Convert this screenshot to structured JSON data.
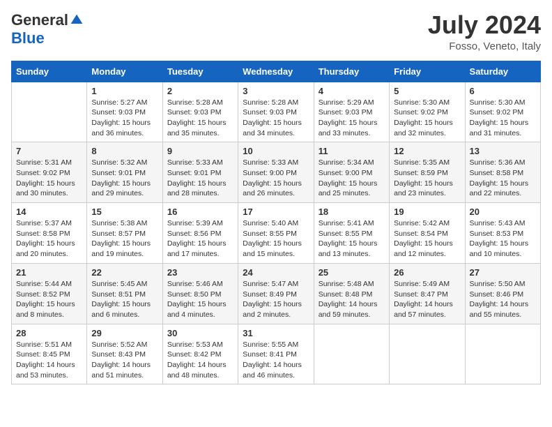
{
  "header": {
    "logo_general": "General",
    "logo_blue": "Blue",
    "title": "July 2024",
    "subtitle": "Fosso, Veneto, Italy"
  },
  "days_of_week": [
    "Sunday",
    "Monday",
    "Tuesday",
    "Wednesday",
    "Thursday",
    "Friday",
    "Saturday"
  ],
  "weeks": [
    [
      {
        "day": "",
        "sunrise": "",
        "sunset": "",
        "daylight": ""
      },
      {
        "day": "1",
        "sunrise": "Sunrise: 5:27 AM",
        "sunset": "Sunset: 9:03 PM",
        "daylight": "Daylight: 15 hours and 36 minutes."
      },
      {
        "day": "2",
        "sunrise": "Sunrise: 5:28 AM",
        "sunset": "Sunset: 9:03 PM",
        "daylight": "Daylight: 15 hours and 35 minutes."
      },
      {
        "day": "3",
        "sunrise": "Sunrise: 5:28 AM",
        "sunset": "Sunset: 9:03 PM",
        "daylight": "Daylight: 15 hours and 34 minutes."
      },
      {
        "day": "4",
        "sunrise": "Sunrise: 5:29 AM",
        "sunset": "Sunset: 9:03 PM",
        "daylight": "Daylight: 15 hours and 33 minutes."
      },
      {
        "day": "5",
        "sunrise": "Sunrise: 5:30 AM",
        "sunset": "Sunset: 9:02 PM",
        "daylight": "Daylight: 15 hours and 32 minutes."
      },
      {
        "day": "6",
        "sunrise": "Sunrise: 5:30 AM",
        "sunset": "Sunset: 9:02 PM",
        "daylight": "Daylight: 15 hours and 31 minutes."
      }
    ],
    [
      {
        "day": "7",
        "sunrise": "Sunrise: 5:31 AM",
        "sunset": "Sunset: 9:02 PM",
        "daylight": "Daylight: 15 hours and 30 minutes."
      },
      {
        "day": "8",
        "sunrise": "Sunrise: 5:32 AM",
        "sunset": "Sunset: 9:01 PM",
        "daylight": "Daylight: 15 hours and 29 minutes."
      },
      {
        "day": "9",
        "sunrise": "Sunrise: 5:33 AM",
        "sunset": "Sunset: 9:01 PM",
        "daylight": "Daylight: 15 hours and 28 minutes."
      },
      {
        "day": "10",
        "sunrise": "Sunrise: 5:33 AM",
        "sunset": "Sunset: 9:00 PM",
        "daylight": "Daylight: 15 hours and 26 minutes."
      },
      {
        "day": "11",
        "sunrise": "Sunrise: 5:34 AM",
        "sunset": "Sunset: 9:00 PM",
        "daylight": "Daylight: 15 hours and 25 minutes."
      },
      {
        "day": "12",
        "sunrise": "Sunrise: 5:35 AM",
        "sunset": "Sunset: 8:59 PM",
        "daylight": "Daylight: 15 hours and 23 minutes."
      },
      {
        "day": "13",
        "sunrise": "Sunrise: 5:36 AM",
        "sunset": "Sunset: 8:58 PM",
        "daylight": "Daylight: 15 hours and 22 minutes."
      }
    ],
    [
      {
        "day": "14",
        "sunrise": "Sunrise: 5:37 AM",
        "sunset": "Sunset: 8:58 PM",
        "daylight": "Daylight: 15 hours and 20 minutes."
      },
      {
        "day": "15",
        "sunrise": "Sunrise: 5:38 AM",
        "sunset": "Sunset: 8:57 PM",
        "daylight": "Daylight: 15 hours and 19 minutes."
      },
      {
        "day": "16",
        "sunrise": "Sunrise: 5:39 AM",
        "sunset": "Sunset: 8:56 PM",
        "daylight": "Daylight: 15 hours and 17 minutes."
      },
      {
        "day": "17",
        "sunrise": "Sunrise: 5:40 AM",
        "sunset": "Sunset: 8:55 PM",
        "daylight": "Daylight: 15 hours and 15 minutes."
      },
      {
        "day": "18",
        "sunrise": "Sunrise: 5:41 AM",
        "sunset": "Sunset: 8:55 PM",
        "daylight": "Daylight: 15 hours and 13 minutes."
      },
      {
        "day": "19",
        "sunrise": "Sunrise: 5:42 AM",
        "sunset": "Sunset: 8:54 PM",
        "daylight": "Daylight: 15 hours and 12 minutes."
      },
      {
        "day": "20",
        "sunrise": "Sunrise: 5:43 AM",
        "sunset": "Sunset: 8:53 PM",
        "daylight": "Daylight: 15 hours and 10 minutes."
      }
    ],
    [
      {
        "day": "21",
        "sunrise": "Sunrise: 5:44 AM",
        "sunset": "Sunset: 8:52 PM",
        "daylight": "Daylight: 15 hours and 8 minutes."
      },
      {
        "day": "22",
        "sunrise": "Sunrise: 5:45 AM",
        "sunset": "Sunset: 8:51 PM",
        "daylight": "Daylight: 15 hours and 6 minutes."
      },
      {
        "day": "23",
        "sunrise": "Sunrise: 5:46 AM",
        "sunset": "Sunset: 8:50 PM",
        "daylight": "Daylight: 15 hours and 4 minutes."
      },
      {
        "day": "24",
        "sunrise": "Sunrise: 5:47 AM",
        "sunset": "Sunset: 8:49 PM",
        "daylight": "Daylight: 15 hours and 2 minutes."
      },
      {
        "day": "25",
        "sunrise": "Sunrise: 5:48 AM",
        "sunset": "Sunset: 8:48 PM",
        "daylight": "Daylight: 14 hours and 59 minutes."
      },
      {
        "day": "26",
        "sunrise": "Sunrise: 5:49 AM",
        "sunset": "Sunset: 8:47 PM",
        "daylight": "Daylight: 14 hours and 57 minutes."
      },
      {
        "day": "27",
        "sunrise": "Sunrise: 5:50 AM",
        "sunset": "Sunset: 8:46 PM",
        "daylight": "Daylight: 14 hours and 55 minutes."
      }
    ],
    [
      {
        "day": "28",
        "sunrise": "Sunrise: 5:51 AM",
        "sunset": "Sunset: 8:45 PM",
        "daylight": "Daylight: 14 hours and 53 minutes."
      },
      {
        "day": "29",
        "sunrise": "Sunrise: 5:52 AM",
        "sunset": "Sunset: 8:43 PM",
        "daylight": "Daylight: 14 hours and 51 minutes."
      },
      {
        "day": "30",
        "sunrise": "Sunrise: 5:53 AM",
        "sunset": "Sunset: 8:42 PM",
        "daylight": "Daylight: 14 hours and 48 minutes."
      },
      {
        "day": "31",
        "sunrise": "Sunrise: 5:55 AM",
        "sunset": "Sunset: 8:41 PM",
        "daylight": "Daylight: 14 hours and 46 minutes."
      },
      {
        "day": "",
        "sunrise": "",
        "sunset": "",
        "daylight": ""
      },
      {
        "day": "",
        "sunrise": "",
        "sunset": "",
        "daylight": ""
      },
      {
        "day": "",
        "sunrise": "",
        "sunset": "",
        "daylight": ""
      }
    ]
  ]
}
